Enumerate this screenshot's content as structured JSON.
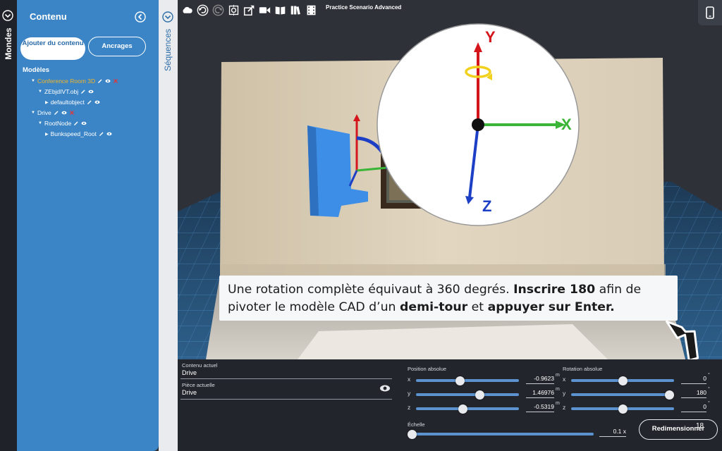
{
  "toolbar": {
    "scenario_title": "Practice Scenario Advanced",
    "icons": [
      "cloud-icon",
      "undo-icon",
      "redo-icon",
      "focus-icon",
      "share-icon",
      "video-icon",
      "book-icon",
      "library-icon",
      "film-icon"
    ]
  },
  "mondes_panel": {
    "label": "Mondes"
  },
  "content_panel": {
    "title": "Contenu",
    "add_button": "Ajouter du contenu",
    "anchors_button": "Ancrages",
    "models_title": "Modèles",
    "tree": [
      {
        "label": "Conference Room 3D",
        "active": true
      },
      {
        "label": "ZEbjdIVT.obj"
      },
      {
        "label": "defaultobject"
      },
      {
        "label": "Drive"
      },
      {
        "label": "RootNode"
      },
      {
        "label": "Bunkspeed_Root"
      }
    ]
  },
  "sequences_panel": {
    "label": "Séquences"
  },
  "gizmo": {
    "y_label": "Y",
    "x_label": "X",
    "z_label": "Z"
  },
  "instruction": {
    "part1": "Une rotation complète équivaut à 360 degrés. ",
    "bold1": "Inscrire 180",
    "part2": " afin de pivoter le modèle CAD d’un ",
    "bold2": "demi-tour",
    "part3": " et ",
    "bold3": "appuyer sur Enter."
  },
  "properties": {
    "current_content_label": "Contenu actuel",
    "current_content_value": "Drive",
    "current_part_label": "Pièce actuelle",
    "current_part_value": "Drive",
    "position_title": "Position absolue",
    "position": [
      {
        "axis": "x",
        "value": "-0.9623",
        "unit": "m",
        "fraction": 0.42
      },
      {
        "axis": "y",
        "value": "1.46976",
        "unit": "m",
        "fraction": 0.63
      },
      {
        "axis": "z",
        "value": "-0.5319",
        "unit": "m",
        "fraction": 0.45
      }
    ],
    "rotation_title": "Rotation absolue",
    "rotation": [
      {
        "axis": "x",
        "value": "0",
        "unit": "°",
        "fraction": 0.5
      },
      {
        "axis": "y",
        "value": "180",
        "unit": "°",
        "fraction": 1.0
      },
      {
        "axis": "z",
        "value": "0",
        "unit": "°",
        "fraction": 0.5
      }
    ],
    "scale_title": "Échelle",
    "scale_value": "0.1 x",
    "scale_fraction": 0.0,
    "resize_button": "Redimensionner",
    "page_number": "18"
  },
  "colors": {
    "panel_blue": "#3b85c6",
    "accent_blue": "#5b92cf",
    "x_axis": "#3bb537",
    "y_axis": "#d4161c",
    "z_axis": "#1c3fc6"
  }
}
